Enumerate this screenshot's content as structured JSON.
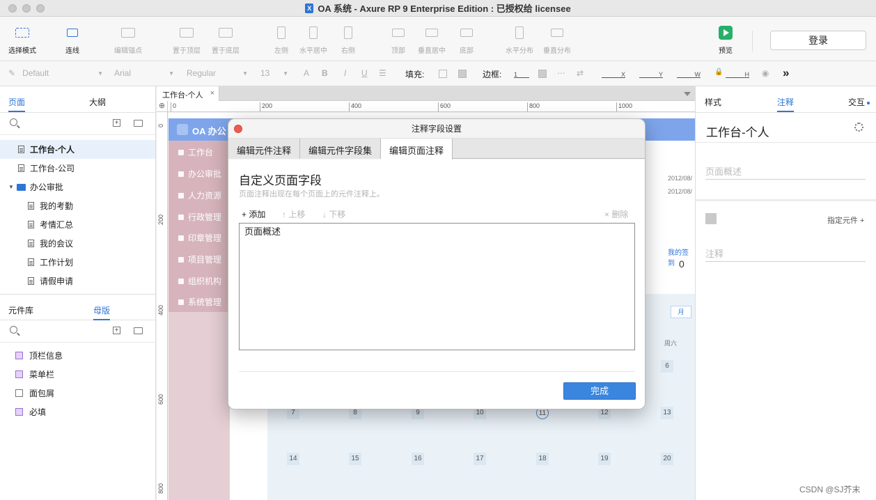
{
  "window": {
    "title": "OA 系统 - Axure RP 9 Enterprise Edition : 已授权给 licensee",
    "app_icon": "axure-icon"
  },
  "toolbar": {
    "tools": [
      {
        "label": "选择模式",
        "icon": "select-mode-icon",
        "active": true
      },
      {
        "label": "连线",
        "icon": "connector-icon",
        "active": true
      },
      {
        "label": "编辑锚点",
        "icon": "anchor-icon",
        "active": false
      },
      {
        "label": "置于顶层",
        "icon": "bring-front-icon",
        "active": false
      },
      {
        "label": "置于底层",
        "icon": "send-back-icon",
        "active": false
      },
      {
        "label": "左侧",
        "icon": "align-left-icon",
        "active": false
      },
      {
        "label": "水平居中",
        "icon": "align-hcenter-icon",
        "active": false
      },
      {
        "label": "右侧",
        "icon": "align-right-icon",
        "active": false
      },
      {
        "label": "顶部",
        "icon": "align-top-icon",
        "active": false
      },
      {
        "label": "垂直居中",
        "icon": "align-vcenter-icon",
        "active": false
      },
      {
        "label": "底部",
        "icon": "align-bottom-icon",
        "active": false
      },
      {
        "label": "水平分布",
        "icon": "distribute-h-icon",
        "active": false
      },
      {
        "label": "垂直分布",
        "icon": "distribute-v-icon",
        "active": false
      }
    ],
    "preview_label": "预览",
    "login_label": "登录"
  },
  "format_bar": {
    "style": "Default",
    "font": "Arial",
    "weight": "Regular",
    "size": "13",
    "fill_label": "填充:",
    "border_label": "边框:",
    "border_value": "1",
    "x_label": "X",
    "y_label": "Y",
    "w_label": "W",
    "h_label": "H"
  },
  "left_panel": {
    "tabs": [
      "页面",
      "大纲"
    ],
    "pages": [
      {
        "label": "工作台-个人",
        "level": 1,
        "selected": true,
        "type": "page"
      },
      {
        "label": "工作台-公司",
        "level": 1,
        "selected": false,
        "type": "page"
      },
      {
        "label": "办公审批",
        "level": 1,
        "selected": false,
        "type": "folder"
      },
      {
        "label": "我的考勤",
        "level": 2,
        "selected": false,
        "type": "page"
      },
      {
        "label": "考情汇总",
        "level": 2,
        "selected": false,
        "type": "page"
      },
      {
        "label": "我的会议",
        "level": 2,
        "selected": false,
        "type": "page"
      },
      {
        "label": "工作计划",
        "level": 2,
        "selected": false,
        "type": "page"
      },
      {
        "label": "请假申请",
        "level": 2,
        "selected": false,
        "type": "page"
      }
    ],
    "lib_tabs": [
      "元件库",
      "母版"
    ],
    "masters": [
      {
        "label": "顶栏信息",
        "plain": false
      },
      {
        "label": "菜单栏",
        "plain": false
      },
      {
        "label": "面包屑",
        "plain": true
      },
      {
        "label": "必填",
        "plain": false
      }
    ]
  },
  "canvas": {
    "tab_label": "工作台-个人",
    "tab_close": "×",
    "ruler_h": [
      "0",
      "200",
      "400",
      "600",
      "800",
      "1000"
    ],
    "ruler_v": [
      "0",
      "200",
      "400",
      "600",
      "800"
    ],
    "oa_title": "OA 办公",
    "menu": [
      "工作台",
      "办公审批",
      "人力资源",
      "行政管理",
      "印章管理",
      "项目管理",
      "组织机构",
      "系统管理"
    ],
    "dates": [
      "2012/08/",
      "2012/08/"
    ],
    "sign_label": "我的签到",
    "sign_value": "0",
    "month_btn": "月",
    "weekday": "周六",
    "cal_row1": [
      "6"
    ],
    "cal_row2": [
      "7",
      "8",
      "9",
      "10",
      "11",
      "12",
      "13"
    ],
    "cal_row3": [
      "14",
      "15",
      "16",
      "17",
      "18",
      "19",
      "20"
    ]
  },
  "dialog": {
    "title": "注释字段设置",
    "tabs": [
      "编辑元件注释",
      "编辑元件字段集",
      "编辑页面注释"
    ],
    "heading": "自定义页面字段",
    "description": "页面注释出现在每个页面上的元件注释上。",
    "actions": {
      "add": "+ 添加",
      "up": "↑ 上移",
      "down": "↓ 下移",
      "delete": "× 删除"
    },
    "fields": [
      "页面概述"
    ],
    "done_label": "完成"
  },
  "right_panel": {
    "tabs": [
      "样式",
      "注释",
      "交互"
    ],
    "page_title": "工作台-个人",
    "page_summary_placeholder": "页面概述",
    "assign_label": "指定元件 +",
    "note_placeholder": "注释"
  },
  "watermark": "CSDN @SJ芥末",
  "colors": {
    "accent": "#2f75d6",
    "done_button": "#3a86de",
    "close_red": "#ee5b50",
    "preview_green": "#27b06a"
  }
}
